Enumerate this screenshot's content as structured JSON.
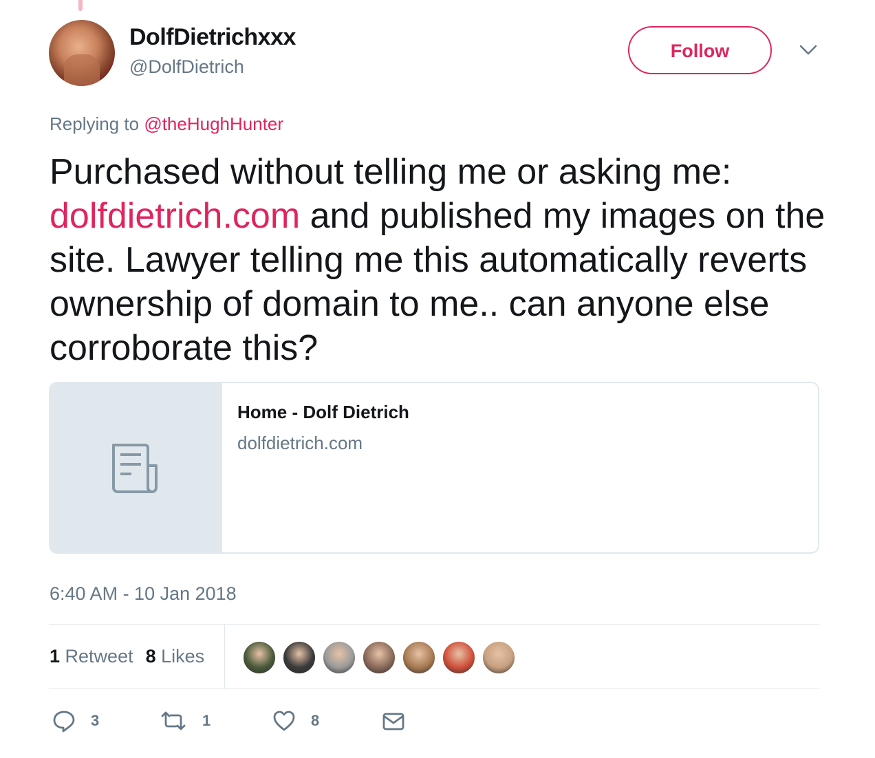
{
  "user": {
    "display_name": "DolfDietrichxxx",
    "handle": "@DolfDietrich"
  },
  "follow_label": "Follow",
  "replying": {
    "prefix": "Replying to",
    "mention": "@theHughHunter"
  },
  "tweet": {
    "text_before": "Purchased without telling me or asking me: ",
    "link": "dolfdietrich.com",
    "text_after": " and published my images on the site. Lawyer telling me this automatically reverts ownership of domain to me.. can anyone else corroborate this?"
  },
  "card": {
    "title": "Home - Dolf Dietrich",
    "domain": "dolfdietrich.com"
  },
  "timestamp": "6:40 AM - 10 Jan 2018",
  "stats": {
    "retweets_count": "1",
    "retweets_label": "Retweet",
    "likes_count": "8",
    "likes_label": "Likes"
  },
  "liker_colors": [
    "#4a5a3a",
    "#3a3a3a",
    "#9a9a9a",
    "#8a6a5a",
    "#a87a52",
    "#d0503a",
    "#c8a080"
  ],
  "actions": {
    "replies": "3",
    "retweets": "1",
    "likes": "8"
  },
  "colors": {
    "accent": "#e0245e",
    "secondary_text": "#657786",
    "border": "#e1e8ed"
  }
}
